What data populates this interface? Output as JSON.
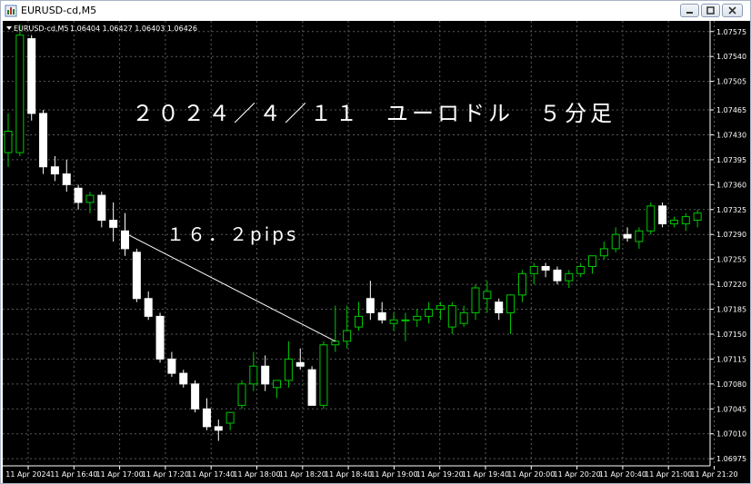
{
  "window": {
    "title": "EURUSD-cd,M5",
    "icon": "chart-window-icon",
    "buttons": [
      "minimize-icon",
      "maximize-icon",
      "close-icon"
    ]
  },
  "chart_header": {
    "symbol_label": "EURUSD-cd,M5",
    "ohlc_label": "1.06404 1.06427 1.06403 1.06426"
  },
  "annotations": {
    "title": "２０２４／４／１１　ユーロドル　５分足",
    "pips": "１６．２pips"
  },
  "colors": {
    "background": "#000000",
    "grid": "#5a5a5a",
    "bull": "#00c800",
    "bear": "#ffffff",
    "text": "#ffffff"
  },
  "chart_data": {
    "type": "candlestick",
    "title": "２０２４／４／１１　ユーロドル　５分足",
    "symbol": "EURUSD-cd",
    "timeframe": "M5",
    "ylim": [
      1.06965,
      1.0759
    ],
    "y_ticks": [
      "1.07575",
      "1.07540",
      "1.07505",
      "1.07465",
      "1.07430",
      "1.07395",
      "1.07360",
      "1.07325",
      "1.07290",
      "1.07255",
      "1.07220",
      "1.07185",
      "1.07150",
      "1.07115",
      "1.07080",
      "1.07045",
      "1.07010",
      "1.06975"
    ],
    "x_ticks": [
      "11 Apr 2024",
      "11 Apr 16:40",
      "11 Apr 17:00",
      "11 Apr 17:20",
      "11 Apr 17:40",
      "11 Apr 18:00",
      "11 Apr 18:20",
      "11 Apr 18:40",
      "11 Apr 19:00",
      "11 Apr 19:20",
      "11 Apr 19:40",
      "11 Apr 20:00",
      "11 Apr 20:20",
      "11 Apr 20:40",
      "11 Apr 21:00",
      "11 Apr 21:20"
    ],
    "grid": true,
    "candles": [
      {
        "o": 1.07405,
        "h": 1.0746,
        "l": 1.07385,
        "c": 1.07435
      },
      {
        "o": 1.07405,
        "h": 1.07585,
        "l": 1.074,
        "c": 1.0757
      },
      {
        "o": 1.07565,
        "h": 1.0757,
        "l": 1.0745,
        "c": 1.0746
      },
      {
        "o": 1.0746,
        "h": 1.07465,
        "l": 1.07375,
        "c": 1.07385
      },
      {
        "o": 1.07385,
        "h": 1.074,
        "l": 1.07365,
        "c": 1.07375
      },
      {
        "o": 1.07375,
        "h": 1.07395,
        "l": 1.0735,
        "c": 1.0736
      },
      {
        "o": 1.07355,
        "h": 1.0736,
        "l": 1.07325,
        "c": 1.07335
      },
      {
        "o": 1.07335,
        "h": 1.0735,
        "l": 1.0732,
        "c": 1.07345
      },
      {
        "o": 1.07345,
        "h": 1.0735,
        "l": 1.073,
        "c": 1.0731
      },
      {
        "o": 1.0731,
        "h": 1.07335,
        "l": 1.0728,
        "c": 1.073
      },
      {
        "o": 1.07295,
        "h": 1.0732,
        "l": 1.0726,
        "c": 1.0727
      },
      {
        "o": 1.07265,
        "h": 1.0727,
        "l": 1.07195,
        "c": 1.072
      },
      {
        "o": 1.072,
        "h": 1.0721,
        "l": 1.0717,
        "c": 1.07175
      },
      {
        "o": 1.07175,
        "h": 1.0718,
        "l": 1.0711,
        "c": 1.07115
      },
      {
        "o": 1.07115,
        "h": 1.07125,
        "l": 1.0709,
        "c": 1.07095
      },
      {
        "o": 1.07095,
        "h": 1.071,
        "l": 1.07075,
        "c": 1.0708
      },
      {
        "o": 1.0708,
        "h": 1.07085,
        "l": 1.0704,
        "c": 1.07045
      },
      {
        "o": 1.07045,
        "h": 1.0706,
        "l": 1.07015,
        "c": 1.0702
      },
      {
        "o": 1.0702,
        "h": 1.0703,
        "l": 1.07,
        "c": 1.07015
      },
      {
        "o": 1.07025,
        "h": 1.0704,
        "l": 1.07015,
        "c": 1.0704
      },
      {
        "o": 1.0705,
        "h": 1.07085,
        "l": 1.07045,
        "c": 1.0708
      },
      {
        "o": 1.0708,
        "h": 1.07125,
        "l": 1.0707,
        "c": 1.07105
      },
      {
        "o": 1.07105,
        "h": 1.0712,
        "l": 1.0707,
        "c": 1.0708
      },
      {
        "o": 1.07075,
        "h": 1.07085,
        "l": 1.0706,
        "c": 1.07085
      },
      {
        "o": 1.07085,
        "h": 1.0714,
        "l": 1.07075,
        "c": 1.07115
      },
      {
        "o": 1.0711,
        "h": 1.0713,
        "l": 1.071,
        "c": 1.07105
      },
      {
        "o": 1.071,
        "h": 1.07105,
        "l": 1.0705,
        "c": 1.0705
      },
      {
        "o": 1.0705,
        "h": 1.0714,
        "l": 1.07045,
        "c": 1.07135
      },
      {
        "o": 1.07135,
        "h": 1.0719,
        "l": 1.07125,
        "c": 1.0714
      },
      {
        "o": 1.0714,
        "h": 1.0719,
        "l": 1.0713,
        "c": 1.07155
      },
      {
        "o": 1.0716,
        "h": 1.07195,
        "l": 1.07155,
        "c": 1.07175
      },
      {
        "o": 1.072,
        "h": 1.07225,
        "l": 1.0717,
        "c": 1.0718
      },
      {
        "o": 1.0718,
        "h": 1.07195,
        "l": 1.07165,
        "c": 1.0717
      },
      {
        "o": 1.07165,
        "h": 1.0718,
        "l": 1.07155,
        "c": 1.0717
      },
      {
        "o": 1.0717,
        "h": 1.0718,
        "l": 1.0714,
        "c": 1.0717
      },
      {
        "o": 1.0717,
        "h": 1.07185,
        "l": 1.0716,
        "c": 1.07175
      },
      {
        "o": 1.07175,
        "h": 1.07195,
        "l": 1.07165,
        "c": 1.07185
      },
      {
        "o": 1.07185,
        "h": 1.07195,
        "l": 1.0717,
        "c": 1.0719
      },
      {
        "o": 1.0716,
        "h": 1.07195,
        "l": 1.0715,
        "c": 1.0719
      },
      {
        "o": 1.07165,
        "h": 1.0719,
        "l": 1.0716,
        "c": 1.0718
      },
      {
        "o": 1.0718,
        "h": 1.0722,
        "l": 1.0717,
        "c": 1.07215
      },
      {
        "o": 1.072,
        "h": 1.07225,
        "l": 1.0718,
        "c": 1.0721
      },
      {
        "o": 1.07195,
        "h": 1.072,
        "l": 1.0717,
        "c": 1.0718
      },
      {
        "o": 1.0718,
        "h": 1.07205,
        "l": 1.0715,
        "c": 1.07205
      },
      {
        "o": 1.07205,
        "h": 1.0724,
        "l": 1.07195,
        "c": 1.07235
      },
      {
        "o": 1.07235,
        "h": 1.0725,
        "l": 1.0722,
        "c": 1.07245
      },
      {
        "o": 1.07245,
        "h": 1.0725,
        "l": 1.0723,
        "c": 1.0724
      },
      {
        "o": 1.0724,
        "h": 1.07245,
        "l": 1.0722,
        "c": 1.07225
      },
      {
        "o": 1.07225,
        "h": 1.0724,
        "l": 1.07215,
        "c": 1.07235
      },
      {
        "o": 1.07235,
        "h": 1.0725,
        "l": 1.0723,
        "c": 1.07245
      },
      {
        "o": 1.07245,
        "h": 1.0726,
        "l": 1.07235,
        "c": 1.0726
      },
      {
        "o": 1.0726,
        "h": 1.0728,
        "l": 1.07255,
        "c": 1.0727
      },
      {
        "o": 1.0727,
        "h": 1.073,
        "l": 1.07265,
        "c": 1.0729
      },
      {
        "o": 1.0729,
        "h": 1.073,
        "l": 1.0728,
        "c": 1.07285
      },
      {
        "o": 1.0728,
        "h": 1.073,
        "l": 1.0727,
        "c": 1.07295
      },
      {
        "o": 1.07295,
        "h": 1.07335,
        "l": 1.0729,
        "c": 1.0733
      },
      {
        "o": 1.0733,
        "h": 1.07335,
        "l": 1.073,
        "c": 1.07305
      },
      {
        "o": 1.07305,
        "h": 1.07315,
        "l": 1.073,
        "c": 1.0731
      },
      {
        "o": 1.07305,
        "h": 1.0732,
        "l": 1.07295,
        "c": 1.07315
      },
      {
        "o": 1.0731,
        "h": 1.07325,
        "l": 1.073,
        "c": 1.0732
      }
    ],
    "trendline": {
      "from_candle": 10,
      "from_price": 1.07292,
      "to_candle": 28,
      "to_price": 1.0714,
      "label": "１６．２pips"
    }
  }
}
